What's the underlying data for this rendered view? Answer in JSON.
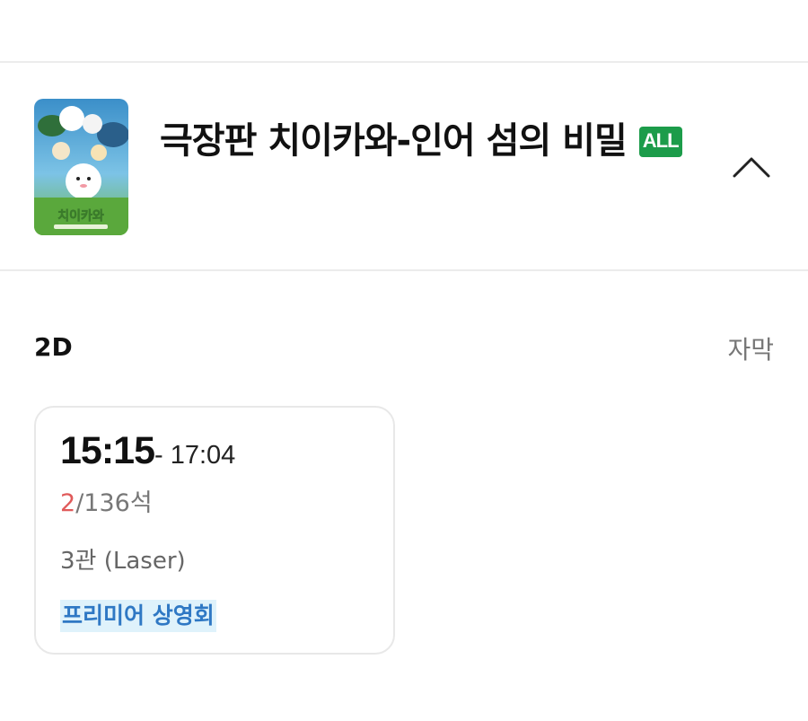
{
  "movie": {
    "title": "극장판 치이카와-인어 섬의 비밀",
    "rating_badge": "ALL",
    "poster_text": "치이카와",
    "collapse_icon": "chevron-up-icon"
  },
  "screening_group": {
    "format": "2D",
    "language": "자막"
  },
  "showtimes": [
    {
      "start": "15:15",
      "end": "- 17:04",
      "seats_available": "2",
      "seats_total": "/136석",
      "hall": "3관 (Laser)",
      "tag": "프리미어 상영회"
    }
  ],
  "colors": {
    "rating_badge_bg": "#1c9c4a",
    "seats_available_red": "#e05a5a",
    "premiere_text_blue": "#2f78c4",
    "premiere_bg": "#dff2fb"
  }
}
